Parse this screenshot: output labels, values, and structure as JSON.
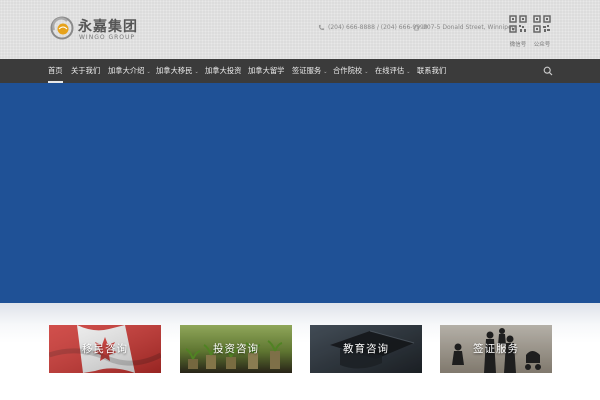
{
  "brand": {
    "name_cn": "永嘉集团",
    "name_en": "WINGO GROUP"
  },
  "contact": {
    "phone": "(204) 666-8888 / (204) 666-9999",
    "address": "207-5 Donald Street, Winnipeg"
  },
  "qr": {
    "wechat_label": "微信号",
    "public_label": "公众号"
  },
  "nav": {
    "items": [
      {
        "label": "首页"
      },
      {
        "label": "关于我们"
      },
      {
        "label": "加拿大介绍",
        "caret": "⌄"
      },
      {
        "label": "加拿大移民",
        "caret": "⌄"
      },
      {
        "label": "加拿大投资"
      },
      {
        "label": "加拿大留学"
      },
      {
        "label": "签证服务",
        "caret": "⌄"
      },
      {
        "label": "合作院校",
        "caret": "⌄"
      },
      {
        "label": "在线评估",
        "caret": "⌄"
      },
      {
        "label": "联系我们"
      }
    ]
  },
  "services": [
    {
      "label": "移民咨询",
      "image": "canada-flag"
    },
    {
      "label": "投资咨询",
      "image": "coin-plants"
    },
    {
      "label": "教育咨询",
      "image": "graduation-cap"
    },
    {
      "label": "签证服务",
      "image": "family-silhouette"
    }
  ],
  "colors": {
    "hero": "#1f5196",
    "nav": "#3b3b3b",
    "header": "#dcdcdc"
  }
}
